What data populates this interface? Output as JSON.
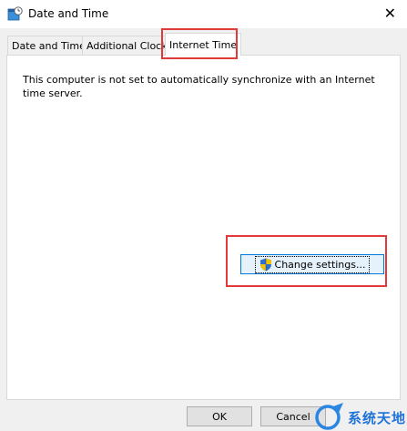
{
  "window": {
    "title": "Date and Time",
    "close_icon": "✕"
  },
  "tabs": [
    {
      "label": "Date and Time",
      "active": false
    },
    {
      "label": "Additional Clocks",
      "active": false
    },
    {
      "label": "Internet Time",
      "active": true
    }
  ],
  "panel": {
    "message": "This computer is not set to automatically synchronize with an Internet time server.",
    "change_settings_label": "Change settings..."
  },
  "buttons": {
    "ok_label": "OK",
    "cancel_label": "Cancel"
  },
  "watermark": {
    "text": "系统天地"
  },
  "colors": {
    "highlight": "#e03a3a",
    "accent": "#0078d7"
  }
}
